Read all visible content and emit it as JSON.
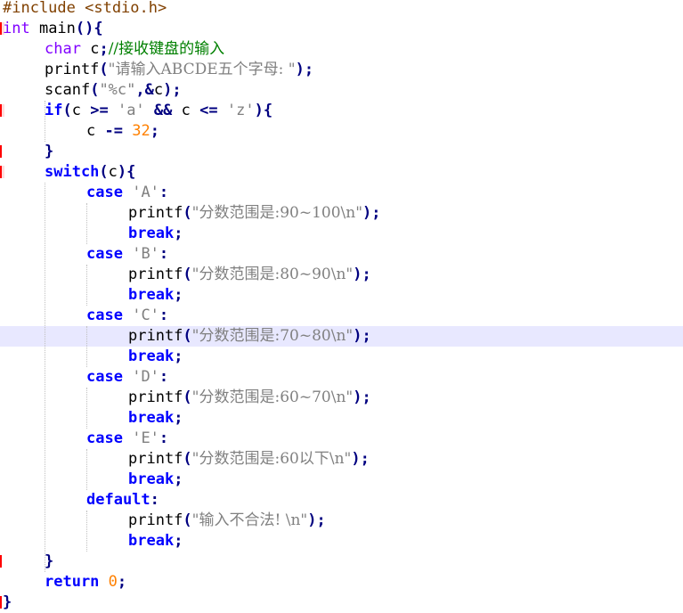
{
  "colors": {
    "preprocessor": "#804000",
    "keyword": "#0000ff",
    "type": "#8000ff",
    "operator": "#000080",
    "string": "#808080",
    "number": "#ff8000",
    "comment": "#008000",
    "identifier": "#000000",
    "current_line_bg": "#e8e8ff",
    "fold_marker": "#ff0000"
  },
  "current_line": 16,
  "lines": [
    {
      "indent": 0,
      "tokens": [
        {
          "t": "pre",
          "v": "#include <stdio.h>"
        }
      ]
    },
    {
      "indent": 0,
      "marker": "fold-start",
      "tokens": [
        {
          "t": "type",
          "v": "int"
        },
        {
          "t": "id",
          "v": " main"
        },
        {
          "t": "op",
          "v": "(){"
        }
      ]
    },
    {
      "indent": 4,
      "tokens": [
        {
          "t": "type",
          "v": "char"
        },
        {
          "t": "id",
          "v": " c"
        },
        {
          "t": "op",
          "v": ";"
        },
        {
          "t": "cmt",
          "v": "//接收键盘的输入"
        }
      ]
    },
    {
      "indent": 4,
      "tokens": [
        {
          "t": "id",
          "v": "printf"
        },
        {
          "t": "op",
          "v": "("
        },
        {
          "t": "str",
          "v": "\"请输入ABCDE五个字母: \""
        },
        {
          "t": "op",
          "v": ");"
        }
      ]
    },
    {
      "indent": 4,
      "tokens": [
        {
          "t": "id",
          "v": "scanf"
        },
        {
          "t": "op",
          "v": "("
        },
        {
          "t": "str",
          "v": "\"%c\""
        },
        {
          "t": "op",
          "v": ",&"
        },
        {
          "t": "id",
          "v": "c"
        },
        {
          "t": "op",
          "v": ");"
        }
      ]
    },
    {
      "indent": 4,
      "marker": "fold-start",
      "tokens": [
        {
          "t": "kw",
          "v": "if"
        },
        {
          "t": "op",
          "v": "("
        },
        {
          "t": "id",
          "v": "c "
        },
        {
          "t": "op",
          "v": ">="
        },
        {
          "t": "id",
          "v": " "
        },
        {
          "t": "str",
          "v": "'a'"
        },
        {
          "t": "id",
          "v": " "
        },
        {
          "t": "op",
          "v": "&&"
        },
        {
          "t": "id",
          "v": " c "
        },
        {
          "t": "op",
          "v": "<="
        },
        {
          "t": "id",
          "v": " "
        },
        {
          "t": "str",
          "v": "'z'"
        },
        {
          "t": "op",
          "v": "){"
        }
      ]
    },
    {
      "indent": 8,
      "tokens": [
        {
          "t": "id",
          "v": "c "
        },
        {
          "t": "op",
          "v": "-="
        },
        {
          "t": "id",
          "v": " "
        },
        {
          "t": "num",
          "v": "32"
        },
        {
          "t": "op",
          "v": ";"
        }
      ]
    },
    {
      "indent": 4,
      "marker": "fold-end",
      "tokens": [
        {
          "t": "op",
          "v": "}"
        }
      ]
    },
    {
      "indent": 4,
      "marker": "fold-start",
      "tokens": [
        {
          "t": "kw",
          "v": "switch"
        },
        {
          "t": "op",
          "v": "("
        },
        {
          "t": "id",
          "v": "c"
        },
        {
          "t": "op",
          "v": "){"
        }
      ]
    },
    {
      "indent": 8,
      "tokens": [
        {
          "t": "kw",
          "v": "case"
        },
        {
          "t": "id",
          "v": " "
        },
        {
          "t": "str",
          "v": "'A'"
        },
        {
          "t": "op",
          "v": ":"
        }
      ]
    },
    {
      "indent": 12,
      "tokens": [
        {
          "t": "id",
          "v": "printf"
        },
        {
          "t": "op",
          "v": "("
        },
        {
          "t": "str",
          "v": "\"分数范围是:90~100\\n\""
        },
        {
          "t": "op",
          "v": ");"
        }
      ]
    },
    {
      "indent": 12,
      "tokens": [
        {
          "t": "kw",
          "v": "break"
        },
        {
          "t": "op",
          "v": ";"
        }
      ]
    },
    {
      "indent": 8,
      "tokens": [
        {
          "t": "kw",
          "v": "case"
        },
        {
          "t": "id",
          "v": " "
        },
        {
          "t": "str",
          "v": "'B'"
        },
        {
          "t": "op",
          "v": ":"
        }
      ]
    },
    {
      "indent": 12,
      "tokens": [
        {
          "t": "id",
          "v": "printf"
        },
        {
          "t": "op",
          "v": "("
        },
        {
          "t": "str",
          "v": "\"分数范围是:80~90\\n\""
        },
        {
          "t": "op",
          "v": ");"
        }
      ]
    },
    {
      "indent": 12,
      "tokens": [
        {
          "t": "kw",
          "v": "break"
        },
        {
          "t": "op",
          "v": ";"
        }
      ]
    },
    {
      "indent": 8,
      "tokens": [
        {
          "t": "kw",
          "v": "case"
        },
        {
          "t": "id",
          "v": " "
        },
        {
          "t": "str",
          "v": "'C'"
        },
        {
          "t": "op",
          "v": ":"
        }
      ]
    },
    {
      "indent": 12,
      "tokens": [
        {
          "t": "id",
          "v": "printf"
        },
        {
          "t": "op",
          "v": "("
        },
        {
          "t": "str",
          "v": "\"分数范围是:70~80\\n\""
        },
        {
          "t": "op",
          "v": ");"
        }
      ]
    },
    {
      "indent": 12,
      "tokens": [
        {
          "t": "kw",
          "v": "break"
        },
        {
          "t": "op",
          "v": ";"
        }
      ]
    },
    {
      "indent": 8,
      "tokens": [
        {
          "t": "kw",
          "v": "case"
        },
        {
          "t": "id",
          "v": " "
        },
        {
          "t": "str",
          "v": "'D'"
        },
        {
          "t": "op",
          "v": ":"
        }
      ]
    },
    {
      "indent": 12,
      "tokens": [
        {
          "t": "id",
          "v": "printf"
        },
        {
          "t": "op",
          "v": "("
        },
        {
          "t": "str",
          "v": "\"分数范围是:60~70\\n\""
        },
        {
          "t": "op",
          "v": ");"
        }
      ]
    },
    {
      "indent": 12,
      "tokens": [
        {
          "t": "kw",
          "v": "break"
        },
        {
          "t": "op",
          "v": ";"
        }
      ]
    },
    {
      "indent": 8,
      "tokens": [
        {
          "t": "kw",
          "v": "case"
        },
        {
          "t": "id",
          "v": " "
        },
        {
          "t": "str",
          "v": "'E'"
        },
        {
          "t": "op",
          "v": ":"
        }
      ]
    },
    {
      "indent": 12,
      "tokens": [
        {
          "t": "id",
          "v": "printf"
        },
        {
          "t": "op",
          "v": "("
        },
        {
          "t": "str",
          "v": "\"分数范围是:60以下\\n\""
        },
        {
          "t": "op",
          "v": ");"
        }
      ]
    },
    {
      "indent": 12,
      "tokens": [
        {
          "t": "kw",
          "v": "break"
        },
        {
          "t": "op",
          "v": ";"
        }
      ]
    },
    {
      "indent": 8,
      "tokens": [
        {
          "t": "kw",
          "v": "default"
        },
        {
          "t": "op",
          "v": ":"
        }
      ]
    },
    {
      "indent": 12,
      "tokens": [
        {
          "t": "id",
          "v": "printf"
        },
        {
          "t": "op",
          "v": "("
        },
        {
          "t": "str",
          "v": "\"输入不合法! \\n\""
        },
        {
          "t": "op",
          "v": ");"
        }
      ]
    },
    {
      "indent": 12,
      "tokens": [
        {
          "t": "kw",
          "v": "break"
        },
        {
          "t": "op",
          "v": ";"
        }
      ]
    },
    {
      "indent": 4,
      "marker": "fold-end",
      "tokens": [
        {
          "t": "op",
          "v": "}"
        }
      ]
    },
    {
      "indent": 4,
      "tokens": [
        {
          "t": "kw",
          "v": "return"
        },
        {
          "t": "id",
          "v": " "
        },
        {
          "t": "num",
          "v": "0"
        },
        {
          "t": "op",
          "v": ";"
        }
      ]
    },
    {
      "indent": 0,
      "marker": "fold-end",
      "tokens": [
        {
          "t": "op",
          "v": "}"
        }
      ]
    }
  ]
}
